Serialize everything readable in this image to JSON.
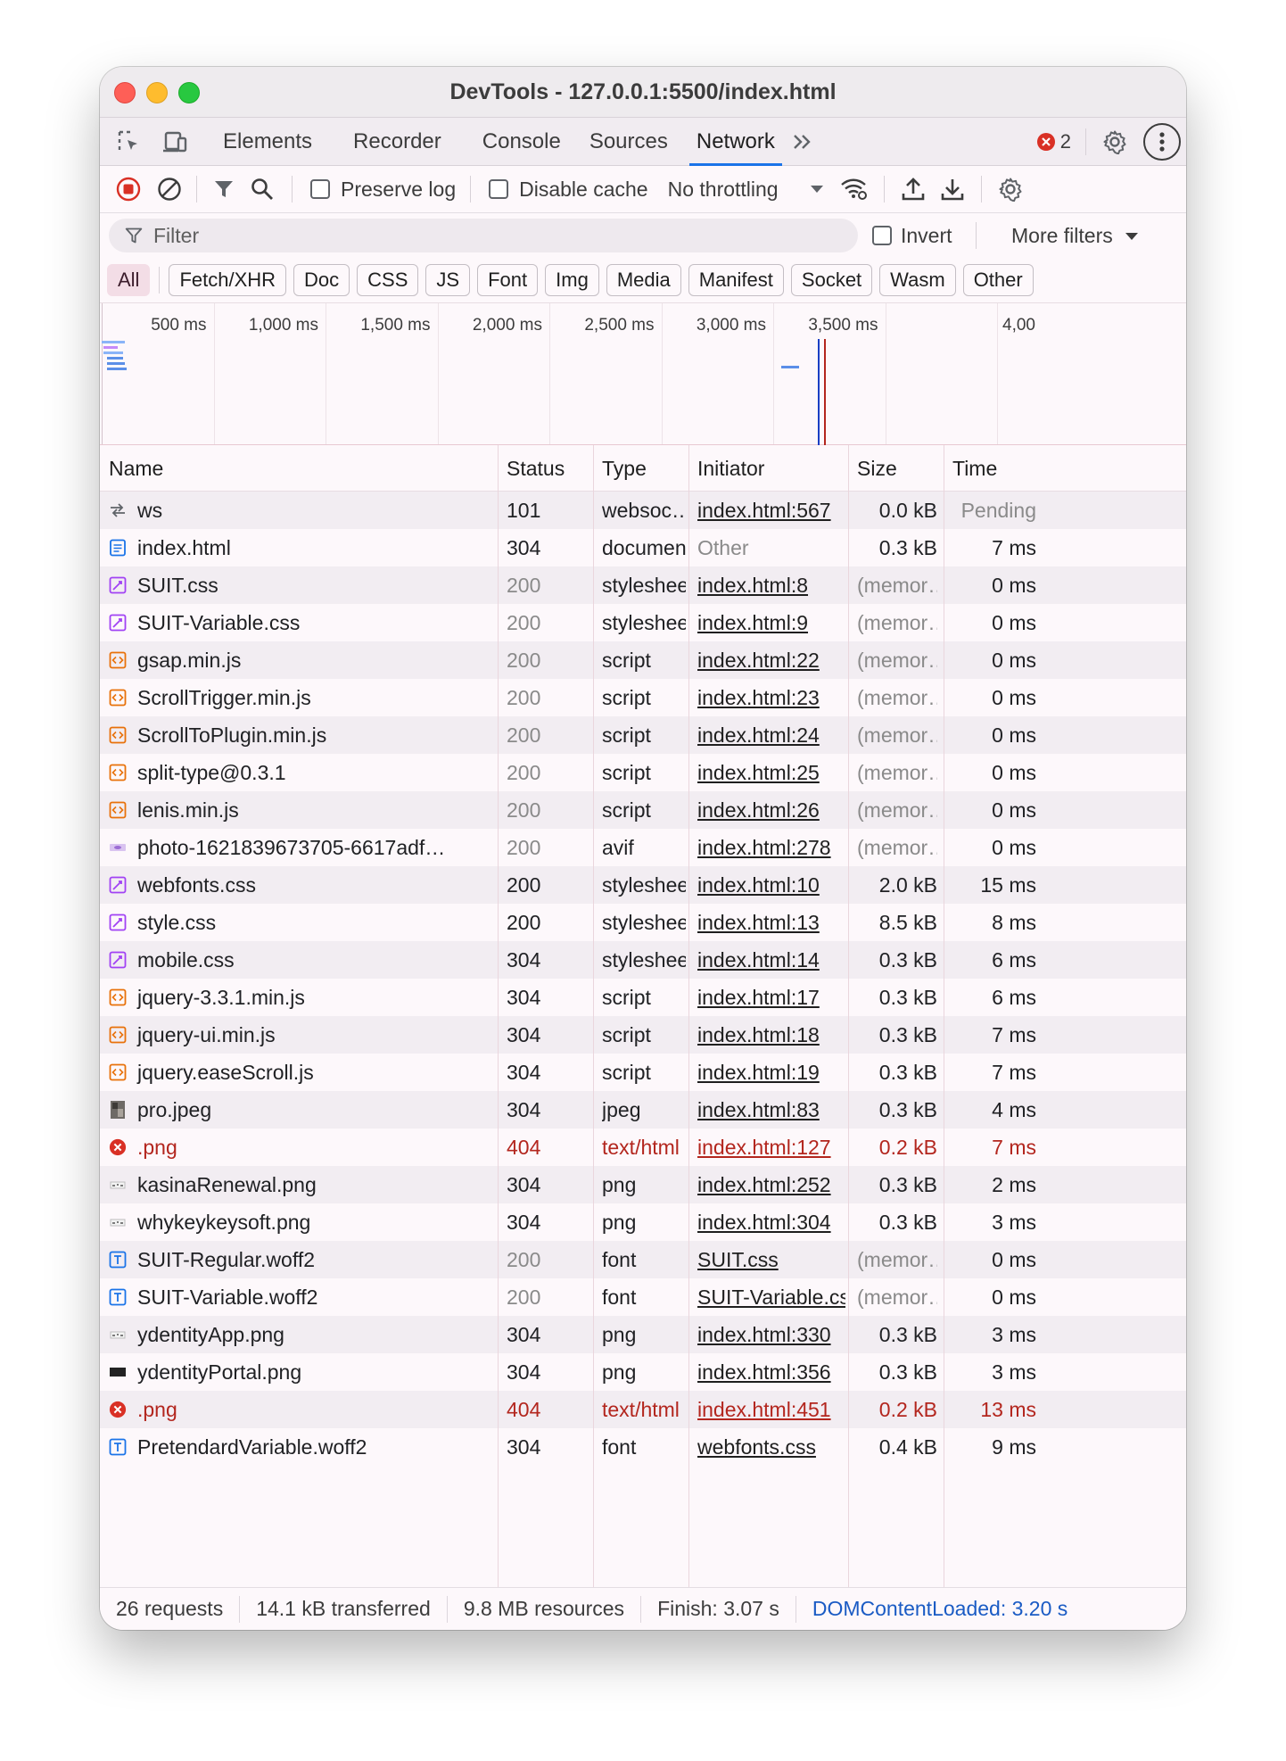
{
  "window": {
    "title": "DevTools - 127.0.0.1:5500/index.html"
  },
  "tabs": [
    {
      "label": "Elements"
    },
    {
      "label": "Recorder"
    },
    {
      "label": "Console"
    },
    {
      "label": "Sources"
    },
    {
      "label": "Network",
      "active": true
    }
  ],
  "error_count": "2",
  "toolbar": {
    "preserve_log": "Preserve log",
    "disable_cache": "Disable cache",
    "throttling": "No throttling"
  },
  "filter": {
    "placeholder": "Filter",
    "invert": "Invert",
    "more_filters": "More filters"
  },
  "type_filters": [
    "All",
    "Fetch/XHR",
    "Doc",
    "CSS",
    "JS",
    "Font",
    "Img",
    "Media",
    "Manifest",
    "Socket",
    "Wasm",
    "Other"
  ],
  "overview": {
    "ticks": [
      "500 ms",
      "1,000 ms",
      "1,500 ms",
      "2,000 ms",
      "2,500 ms",
      "3,000 ms",
      "3,500 ms",
      "4,00"
    ]
  },
  "columns": [
    "Name",
    "Status",
    "Type",
    "Initiator",
    "Size",
    "Time"
  ],
  "requests": [
    {
      "icon": "websocket",
      "name": "ws",
      "status": "101",
      "type": "websoc…",
      "initiator": "index.html:567",
      "size": "0.0 kB",
      "time": "Pending",
      "state": "normal"
    },
    {
      "icon": "document",
      "name": "index.html",
      "status": "304",
      "type": "document",
      "initiator": "Other",
      "size": "0.3 kB",
      "time": "7 ms",
      "state": "normal",
      "initiator_plain": true
    },
    {
      "icon": "stylesheet",
      "name": "SUIT.css",
      "status": "200",
      "type": "stylesheet",
      "initiator": "index.html:8",
      "size": "(memor…",
      "time": "0 ms",
      "state": "cached"
    },
    {
      "icon": "stylesheet",
      "name": "SUIT-Variable.css",
      "status": "200",
      "type": "stylesheet",
      "initiator": "index.html:9",
      "size": "(memor…",
      "time": "0 ms",
      "state": "cached"
    },
    {
      "icon": "script",
      "name": "gsap.min.js",
      "status": "200",
      "type": "script",
      "initiator": "index.html:22",
      "size": "(memor…",
      "time": "0 ms",
      "state": "cached"
    },
    {
      "icon": "script",
      "name": "ScrollTrigger.min.js",
      "status": "200",
      "type": "script",
      "initiator": "index.html:23",
      "size": "(memor…",
      "time": "0 ms",
      "state": "cached"
    },
    {
      "icon": "script",
      "name": "ScrollToPlugin.min.js",
      "status": "200",
      "type": "script",
      "initiator": "index.html:24",
      "size": "(memor…",
      "time": "0 ms",
      "state": "cached"
    },
    {
      "icon": "script",
      "name": "split-type@0.3.1",
      "status": "200",
      "type": "script",
      "initiator": "index.html:25",
      "size": "(memor…",
      "time": "0 ms",
      "state": "cached"
    },
    {
      "icon": "script",
      "name": "lenis.min.js",
      "status": "200",
      "type": "script",
      "initiator": "index.html:26",
      "size": "(memor…",
      "time": "0 ms",
      "state": "cached"
    },
    {
      "icon": "image-thumb-purple",
      "name": "photo-1621839673705-6617adf…",
      "status": "200",
      "type": "avif",
      "initiator": "index.html:278",
      "size": "(memor…",
      "time": "0 ms",
      "state": "cached"
    },
    {
      "icon": "stylesheet",
      "name": "webfonts.css",
      "status": "200",
      "type": "stylesheet",
      "initiator": "index.html:10",
      "size": "2.0 kB",
      "time": "15 ms",
      "state": "normal"
    },
    {
      "icon": "stylesheet",
      "name": "style.css",
      "status": "200",
      "type": "stylesheet",
      "initiator": "index.html:13",
      "size": "8.5 kB",
      "time": "8 ms",
      "state": "normal"
    },
    {
      "icon": "stylesheet",
      "name": "mobile.css",
      "status": "304",
      "type": "stylesheet",
      "initiator": "index.html:14",
      "size": "0.3 kB",
      "time": "6 ms",
      "state": "normal"
    },
    {
      "icon": "script",
      "name": "jquery-3.3.1.min.js",
      "status": "304",
      "type": "script",
      "initiator": "index.html:17",
      "size": "0.3 kB",
      "time": "6 ms",
      "state": "normal"
    },
    {
      "icon": "script",
      "name": "jquery-ui.min.js",
      "status": "304",
      "type": "script",
      "initiator": "index.html:18",
      "size": "0.3 kB",
      "time": "7 ms",
      "state": "normal"
    },
    {
      "icon": "script",
      "name": "jquery.easeScroll.js",
      "status": "304",
      "type": "script",
      "initiator": "index.html:19",
      "size": "0.3 kB",
      "time": "7 ms",
      "state": "normal"
    },
    {
      "icon": "image-thumb-photo",
      "name": "pro.jpeg",
      "status": "304",
      "type": "jpeg",
      "initiator": "index.html:83",
      "size": "0.3 kB",
      "time": "4 ms",
      "state": "normal"
    },
    {
      "icon": "error",
      "name": ".png",
      "status": "404",
      "type": "text/html",
      "initiator": "index.html:127",
      "size": "0.2 kB",
      "time": "7 ms",
      "state": "error"
    },
    {
      "icon": "image-thumb-small",
      "name": "kasinaRenewal.png",
      "status": "304",
      "type": "png",
      "initiator": "index.html:252",
      "size": "0.3 kB",
      "time": "2 ms",
      "state": "normal"
    },
    {
      "icon": "image-thumb-small",
      "name": "whykeykeysoft.png",
      "status": "304",
      "type": "png",
      "initiator": "index.html:304",
      "size": "0.3 kB",
      "time": "3 ms",
      "state": "normal"
    },
    {
      "icon": "font",
      "name": "SUIT-Regular.woff2",
      "status": "200",
      "type": "font",
      "initiator": "SUIT.css",
      "size": "(memor…",
      "time": "0 ms",
      "state": "cached"
    },
    {
      "icon": "font",
      "name": "SUIT-Variable.woff2",
      "status": "200",
      "type": "font",
      "initiator": "SUIT-Variable.css",
      "size": "(memor…",
      "time": "0 ms",
      "state": "cached"
    },
    {
      "icon": "image-thumb-small",
      "name": "ydentityApp.png",
      "status": "304",
      "type": "png",
      "initiator": "index.html:330",
      "size": "0.3 kB",
      "time": "3 ms",
      "state": "normal"
    },
    {
      "icon": "image-thumb-dark",
      "name": "ydentityPortal.png",
      "status": "304",
      "type": "png",
      "initiator": "index.html:356",
      "size": "0.3 kB",
      "time": "3 ms",
      "state": "normal"
    },
    {
      "icon": "error",
      "name": ".png",
      "status": "404",
      "type": "text/html",
      "initiator": "index.html:451",
      "size": "0.2 kB",
      "time": "13 ms",
      "state": "error"
    },
    {
      "icon": "font",
      "name": "PretendardVariable.woff2",
      "status": "304",
      "type": "font",
      "initiator": "webfonts.css",
      "size": "0.4 kB",
      "time": "9 ms",
      "state": "normal"
    }
  ],
  "status": {
    "requests": "26 requests",
    "transferred": "14.1 kB transferred",
    "resources": "9.8 MB resources",
    "finish": "Finish: 3.07 s",
    "dcl": "DOMContentLoaded: 3.20 s"
  },
  "colors": {
    "accent": "#1a73e8",
    "error": "#b3261e",
    "dcl_line": "#1a3fc4",
    "load_line": "#b3261e"
  }
}
